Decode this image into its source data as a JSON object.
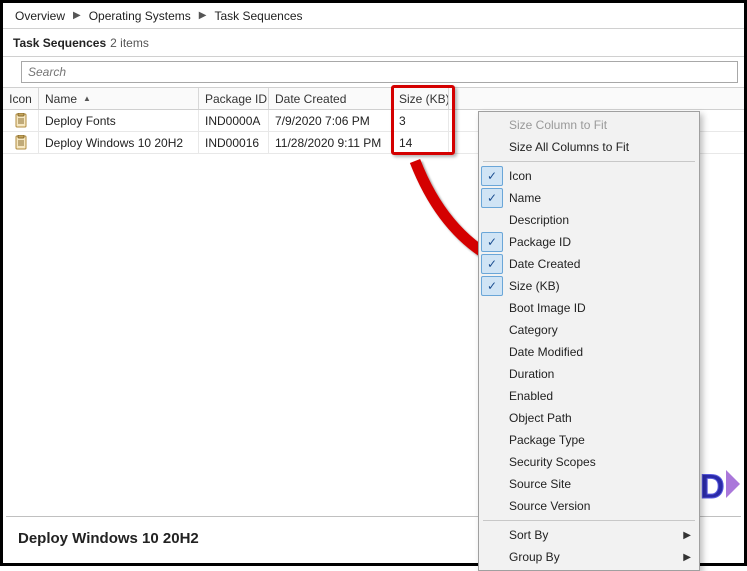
{
  "breadcrumb": [
    "Overview",
    "Operating Systems",
    "Task Sequences"
  ],
  "title": "Task Sequences",
  "count_text": "2 items",
  "search_placeholder": "Search",
  "columns": {
    "icon": "Icon",
    "name": "Name",
    "pkg": "Package ID",
    "date": "Date Created",
    "size": "Size (KB)"
  },
  "rows": [
    {
      "name": "Deploy Fonts",
      "pkg": "IND0000A",
      "date": "7/9/2020 7:06 PM",
      "size": "3"
    },
    {
      "name": "Deploy Windows 10 20H2",
      "pkg": "IND00016",
      "date": "11/28/2020 9:11 PM",
      "size": "14"
    }
  ],
  "context_menu": {
    "size_column": "Size Column to Fit",
    "size_all": "Size All Columns to Fit",
    "cols": [
      {
        "label": "Icon",
        "checked": true
      },
      {
        "label": "Name",
        "checked": true
      },
      {
        "label": "Description",
        "checked": false
      },
      {
        "label": "Package ID",
        "checked": true
      },
      {
        "label": "Date Created",
        "checked": true
      },
      {
        "label": "Size (KB)",
        "checked": true
      },
      {
        "label": "Boot Image ID",
        "checked": false
      },
      {
        "label": "Category",
        "checked": false
      },
      {
        "label": "Date Modified",
        "checked": false
      },
      {
        "label": "Duration",
        "checked": false
      },
      {
        "label": "Enabled",
        "checked": false
      },
      {
        "label": "Object Path",
        "checked": false
      },
      {
        "label": "Package Type",
        "checked": false
      },
      {
        "label": "Security Scopes",
        "checked": false
      },
      {
        "label": "Source Site",
        "checked": false
      },
      {
        "label": "Source Version",
        "checked": false
      }
    ],
    "sort_by": "Sort By",
    "group_by": "Group By"
  },
  "detail_title": "Deploy Windows 10 20H2"
}
